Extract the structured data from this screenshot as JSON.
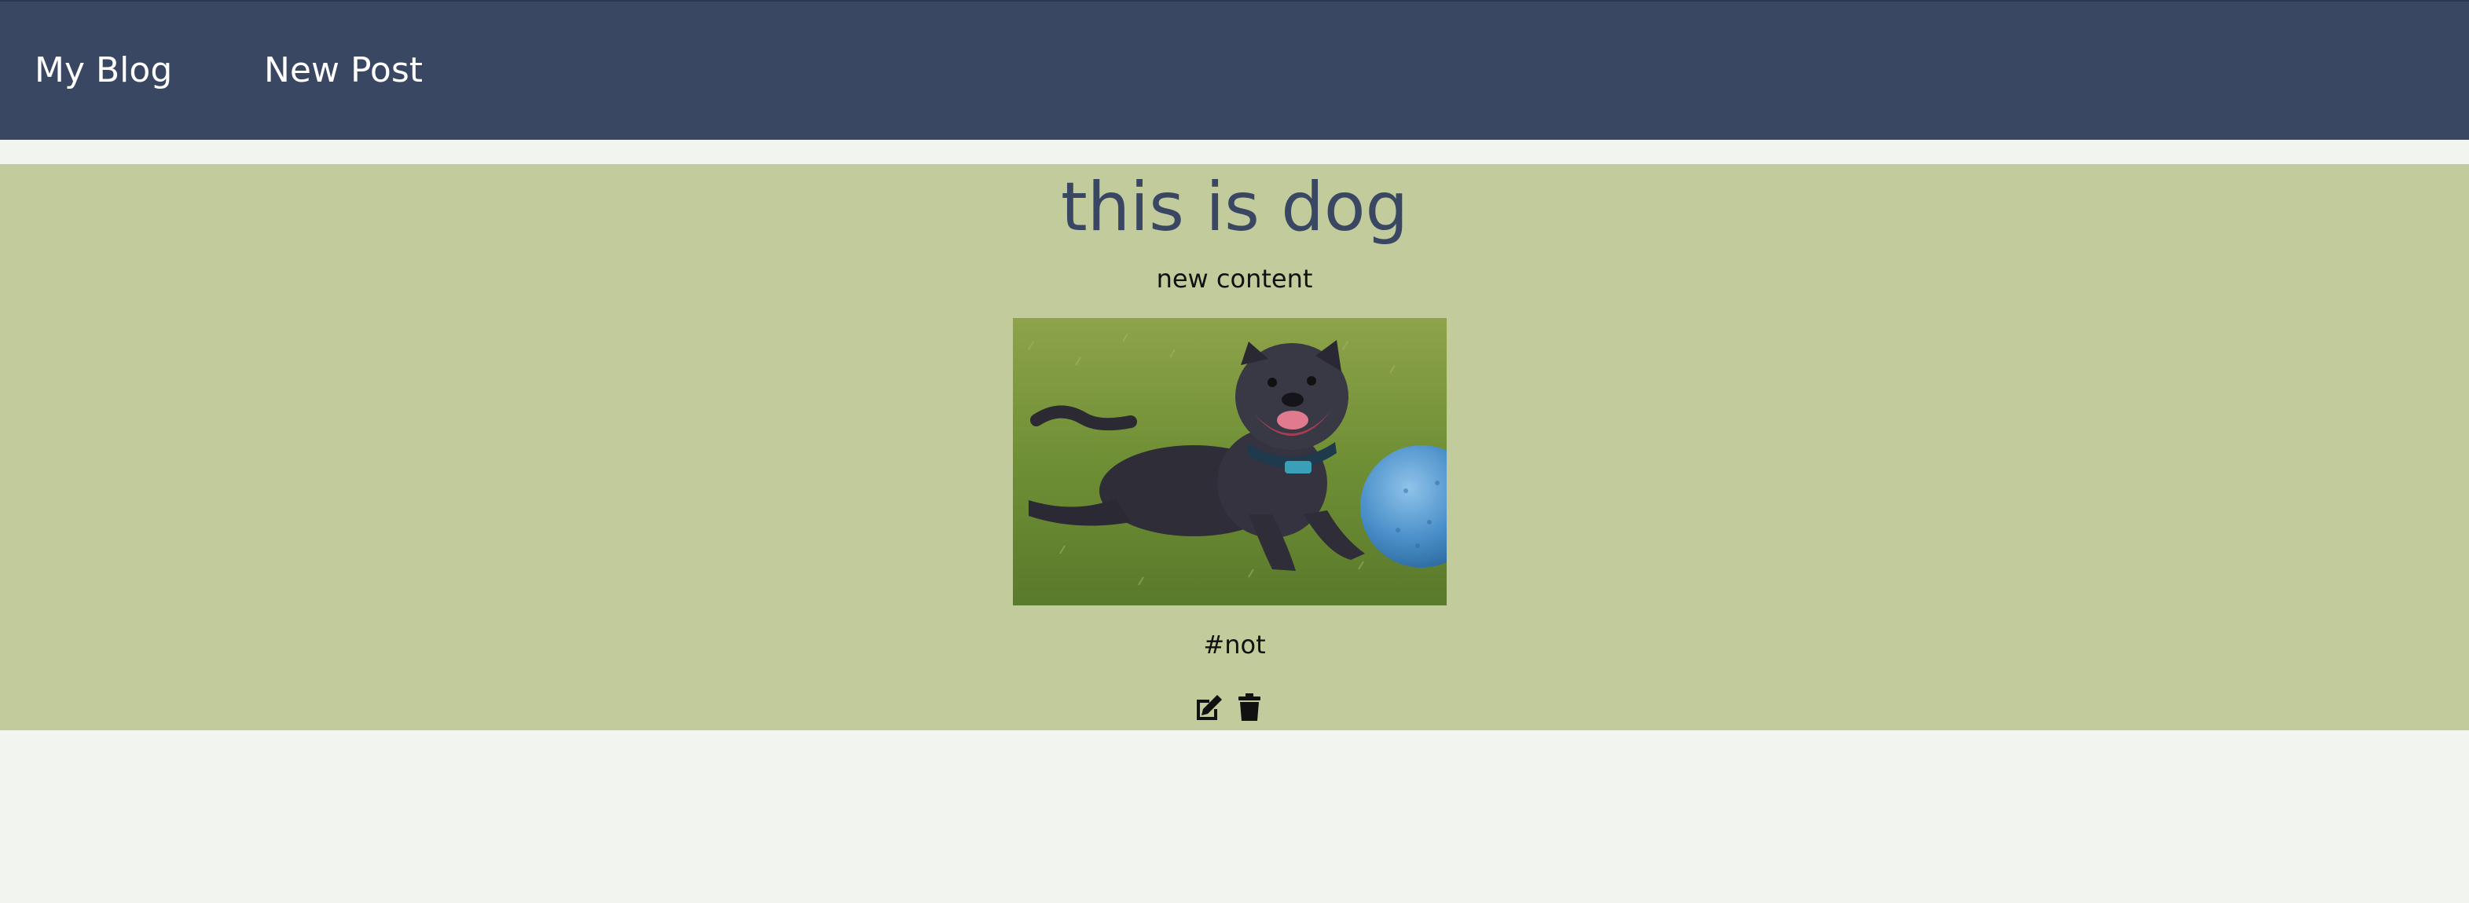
{
  "navbar": {
    "brand": "My Blog",
    "links": [
      {
        "label": "New Post"
      }
    ]
  },
  "post": {
    "title": "this is dog",
    "content": "new content",
    "image": {
      "alt": "dog lying on grass next to a blue ball"
    },
    "tags": "#not",
    "actions": {
      "edit_icon": "edit-icon",
      "delete_icon": "trash-icon"
    }
  },
  "colors": {
    "navbar_bg": "#394763",
    "post_bg": "#c2cb9c",
    "page_bg": "#f2f4ef",
    "title_color": "#394763"
  }
}
